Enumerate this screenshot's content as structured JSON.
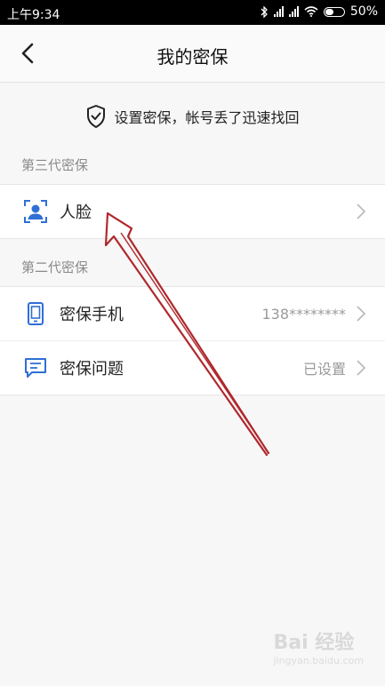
{
  "status_bar": {
    "time": "上午9:34",
    "battery_text": "50%",
    "battery_level": 0.5
  },
  "nav": {
    "title": "我的密保",
    "back_icon": "chevron-left-icon"
  },
  "tip": {
    "icon": "shield-check-icon",
    "text": "设置密保，帐号丢了迅速找回"
  },
  "sections": [
    {
      "label": "第三代密保",
      "items": [
        {
          "label": "人脸",
          "value": "",
          "icon": "face-scan-icon"
        }
      ]
    },
    {
      "label": "第二代密保",
      "items": [
        {
          "label": "密保手机",
          "value": "138********",
          "icon": "phone-icon"
        },
        {
          "label": "密保问题",
          "value": "已设置",
          "icon": "chat-question-icon"
        }
      ]
    }
  ],
  "watermark": {
    "brand": "Bai 经验",
    "url": "jingyan.baidu.com"
  },
  "colors": {
    "accent": "#2f6fd6",
    "annotation_arrow": "#b0282c"
  }
}
